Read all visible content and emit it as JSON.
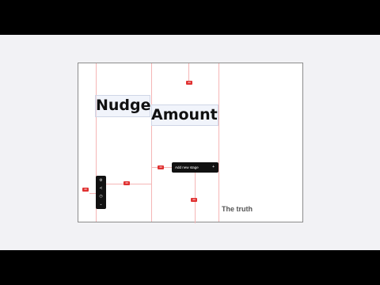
{
  "canvas": {
    "word_one": "Nudge",
    "word_two": "Amount",
    "footer_text": "The truth",
    "button_label": "Add new stage",
    "button_plus": "+"
  },
  "spacing_tags": [
    "40",
    "40",
    "40",
    "40",
    "40"
  ],
  "toolbar": {
    "icons": [
      "gear-icon",
      "share-icon",
      "clock-icon",
      "chevron-down-icon"
    ],
    "glyphs": [
      "⚙",
      "≺",
      "◷",
      "⌄"
    ]
  },
  "colors": {
    "guide": "#f5b6b6",
    "tag": "#e03131",
    "dark": "#111111",
    "stage": "#f2f2f5"
  }
}
